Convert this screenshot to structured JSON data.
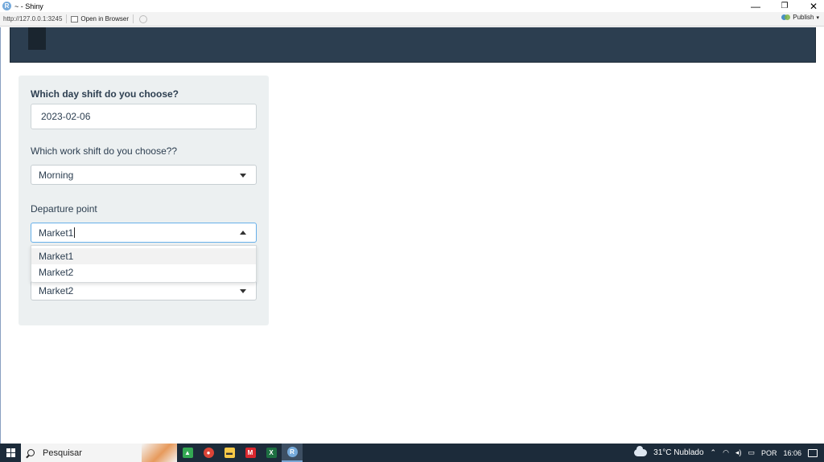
{
  "window": {
    "app_badge": "R",
    "title": "~ - Shiny",
    "minimize": "—",
    "restore": "❐",
    "close": "✕"
  },
  "viewer_toolbar": {
    "url": "http://127.0.0.1:3245",
    "open_in_browser": "Open in Browser",
    "publish": "Publish"
  },
  "form": {
    "date_label": "Which day shift do you choose?",
    "date_value": "2023-02-06",
    "shift_label": "Which work shift do you choose??",
    "shift_value": "Morning",
    "departure_label": "Departure point",
    "departure_value": "Market1",
    "departure_options": [
      "Market1",
      "Market2"
    ],
    "destination_value": "Market2"
  },
  "taskbar": {
    "search_placeholder": "Pesquisar",
    "apps": [
      {
        "name": "google-drive",
        "glyph": "▲",
        "color": "#34a853"
      },
      {
        "name": "chrome",
        "glyph": "●",
        "color": "#db4437"
      },
      {
        "name": "sticky-notes",
        "glyph": "▬",
        "color": "#f7c948"
      },
      {
        "name": "mega",
        "glyph": "M",
        "color": "#d9272e"
      },
      {
        "name": "excel",
        "glyph": "X",
        "color": "#1d6f42"
      },
      {
        "name": "rstudio",
        "glyph": "R",
        "color": "#75aadb"
      }
    ],
    "weather": "31°C  Nublado",
    "language": "POR",
    "time": "16:06"
  }
}
